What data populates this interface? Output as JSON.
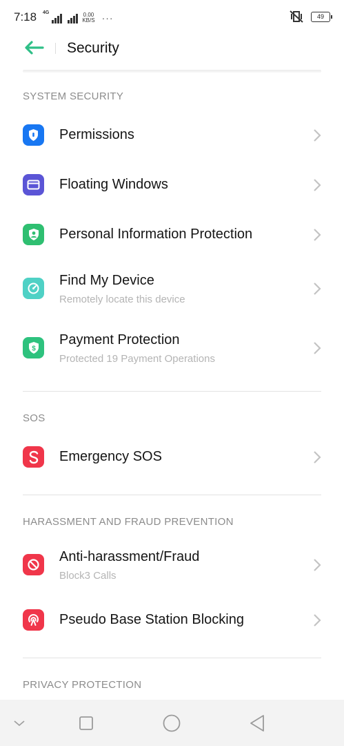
{
  "status": {
    "time": "7:18",
    "network": "4G",
    "netspeed_value": "0.00",
    "netspeed_unit": "KB/S",
    "battery": "49"
  },
  "header": {
    "title": "Security"
  },
  "sections": [
    {
      "heading": "SYSTEM SECURITY"
    },
    {
      "heading": "SOS"
    },
    {
      "heading": "HARASSMENT AND FRAUD PREVENTION"
    },
    {
      "heading": "PRIVACY PROTECTION"
    }
  ],
  "items": [
    {
      "label": "Permissions",
      "sub": "",
      "color": "#1877f2",
      "icon": "shield-lock-icon"
    },
    {
      "label": "Floating Windows",
      "sub": "",
      "color": "#5b55d6",
      "icon": "window-icon"
    },
    {
      "label": "Personal Information Protection",
      "sub": "",
      "color": "#2fbf71",
      "icon": "person-shield-icon"
    },
    {
      "label": "Find My Device",
      "sub": "Remotely locate this device",
      "color": "#4fd1c5",
      "icon": "locate-icon"
    },
    {
      "label": "Payment Protection",
      "sub": "Protected 19 Payment Operations",
      "color": "#2ec27e",
      "icon": "payment-shield-icon"
    },
    {
      "label": "Emergency SOS",
      "sub": "",
      "color": "#f0364a",
      "icon": "sos-icon"
    },
    {
      "label": "Anti-harassment/Fraud",
      "sub": "Block3 Calls",
      "color": "#f0364a",
      "icon": "block-icon"
    },
    {
      "label": "Pseudo Base Station Blocking",
      "sub": "",
      "color": "#f0364a",
      "icon": "antenna-icon"
    }
  ]
}
